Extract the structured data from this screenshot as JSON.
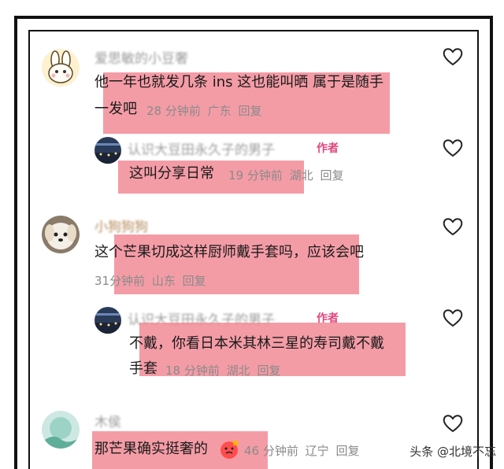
{
  "comments": [
    {
      "username": "爱思敏的小豆奢",
      "text_line1": "他一年也就发几条 ins 这也能叫晒 属于是随手",
      "text_line2": "一发吧",
      "time": "28 分钟前",
      "location": "广东",
      "reply": "回复",
      "avatar_icon": "bunny-avatar-icon"
    },
    {
      "username": "认识大豆田永久子的男子",
      "badge": "作者",
      "text_line1": "这叫分享日常",
      "time": "19 分钟前",
      "location": "湖北",
      "reply": "回复",
      "avatar_icon": "night-scene-avatar-icon"
    },
    {
      "username": "小狗狗狗",
      "text_line1": "这个芒果切成这样厨师戴手套吗，应该会吧",
      "time": "31分钟前",
      "location": "山东",
      "reply": "回复",
      "avatar_icon": "dog-avatar-icon"
    },
    {
      "username": "认识大豆田永久子的男子",
      "badge": "作者",
      "text_line1": "不戴，你看日本米其林三星的寿司戴不戴",
      "text_line2": "手套",
      "time": "18 分钟前",
      "location": "湖北",
      "reply": "回复",
      "avatar_icon": "night-scene-avatar-icon"
    },
    {
      "username": "木侯",
      "text_line1": "那芒果确实挺奢的",
      "time": "46 分钟前",
      "location": "辽宁",
      "reply": "回复",
      "avatar_icon": "landscape-avatar-icon"
    }
  ],
  "watermark": "头条 @北境不忘",
  "colors": {
    "highlight": "#f28b96",
    "badge": "#e0457b",
    "meta": "#8a8a8a"
  }
}
